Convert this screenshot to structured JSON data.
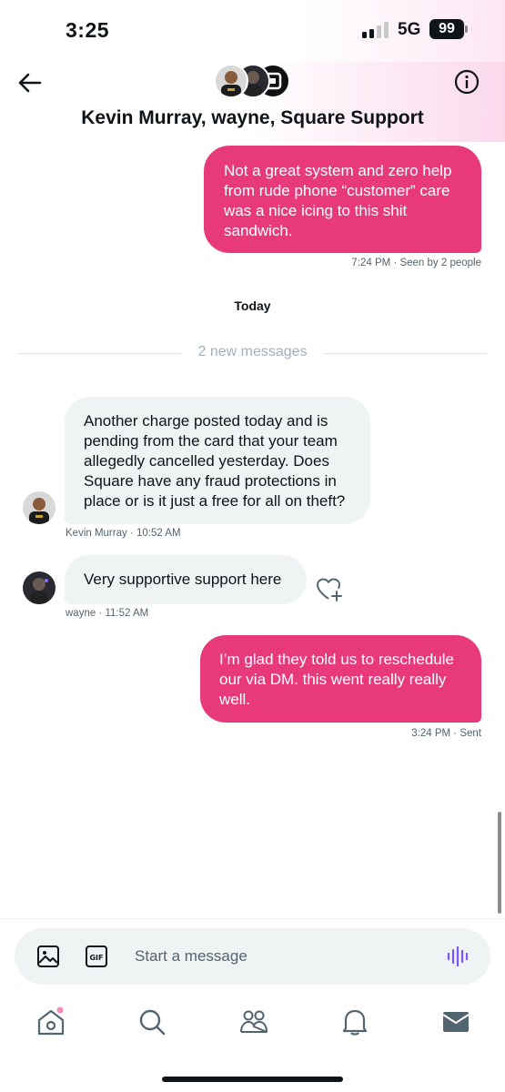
{
  "status": {
    "time": "3:25",
    "network": "5G",
    "battery": "99"
  },
  "header": {
    "title": "Kevin Murray, wayne, Square Support",
    "avatars": [
      "kevin-murray-avatar",
      "wayne-avatar",
      "square-support-avatar"
    ]
  },
  "messages": [
    {
      "direction": "out",
      "text": "Not a great system and zero help from rude phone “customer” care was a nice icing to this shit sandwich.",
      "meta": "7:24 PM · Seen by 2 people"
    },
    {
      "direction": "in",
      "sender": "Kevin Murray",
      "text": "Another charge posted today and is pending from the card that your team allegedly cancelled yesterday. Does Square have any fraud protections in place or is it just a free for all on theft?",
      "meta": "Kevin Murray · 10:52 AM"
    },
    {
      "direction": "in",
      "sender": "wayne",
      "text": "Very supportive support here",
      "meta": "wayne · 11:52 AM"
    },
    {
      "direction": "out",
      "text": "I’m glad they told us to reschedule our via DM. this went really really well.",
      "meta": "3:24 PM · Sent"
    }
  ],
  "day_divider": "Today",
  "new_messages_divider": "2 new messages",
  "composer": {
    "placeholder": "Start a message",
    "icons": [
      "image-icon",
      "gif-icon",
      "voice-icon"
    ]
  },
  "tabbar": {
    "items": [
      "home-icon",
      "search-icon",
      "communities-icon",
      "notifications-icon",
      "messages-icon"
    ]
  },
  "colors": {
    "outgoing_bubble": "#e8397a",
    "incoming_bubble": "#eff3f4",
    "voice_accent": "#7856ff"
  }
}
